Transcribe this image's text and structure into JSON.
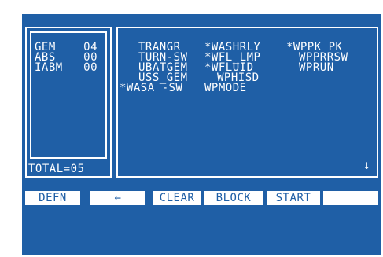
{
  "categories": [
    {
      "label": "GEM",
      "count": "04"
    },
    {
      "label": "ABS",
      "count": "00"
    },
    {
      "label": "IABM",
      "count": "00"
    }
  ],
  "total_label": "TOTAL=05",
  "parameters": [
    [
      "TRANGR",
      "*WASHRLY",
      "*WPPK_PK"
    ],
    [
      "TURN-SW",
      "*WFL_LMP",
      "WPPRRSW"
    ],
    [
      "UBATGEM",
      "*WFLUID",
      "WPRUN"
    ],
    [
      "USS_GEM",
      "WPHISD",
      ""
    ],
    [
      "*WASA_-SW",
      "WPMODE",
      ""
    ]
  ],
  "scroll_indicator": "↓",
  "softkeys": [
    "DEFN",
    "←",
    "CLEAR",
    "BLOCK",
    "START",
    ""
  ],
  "colors": {
    "screen_background": "#1f5fa6",
    "text": "#ffffff",
    "softkey_background": "#ffffff",
    "softkey_text": "#1f5fa6"
  }
}
